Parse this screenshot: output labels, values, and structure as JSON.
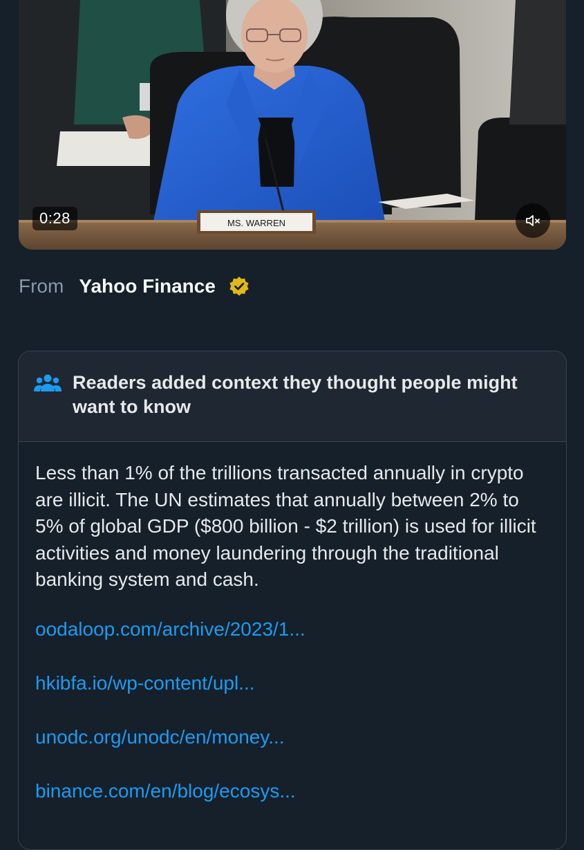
{
  "video": {
    "duration": "0:28",
    "nameplate": "MS. WARREN",
    "mute_icon": "speaker-muted-icon"
  },
  "source": {
    "from_label": "From",
    "name": "Yahoo Finance",
    "badge_icon": "verified-badge-icon",
    "badge_color": "#e2b719"
  },
  "note": {
    "icon": "people-icon",
    "title": "Readers added context they thought people might want to know",
    "body": "Less than 1% of the trillions transacted annually in crypto are illicit. The UN estimates that annually between 2% to 5% of global GDP ($800 billion - $2 trillion) is used for illicit activities and money laundering through the traditional banking system and cash.",
    "links": [
      "oodaloop.com/archive/2023/1...",
      "hkibfa.io/wp-content/upl...",
      "unodc.org/unodc/en/money...",
      "binance.com/en/blog/ecosys..."
    ]
  },
  "colors": {
    "background": "#15202b",
    "link": "#1d9bf0",
    "muted_text": "#8b98a5",
    "note_border": "#38444d"
  }
}
